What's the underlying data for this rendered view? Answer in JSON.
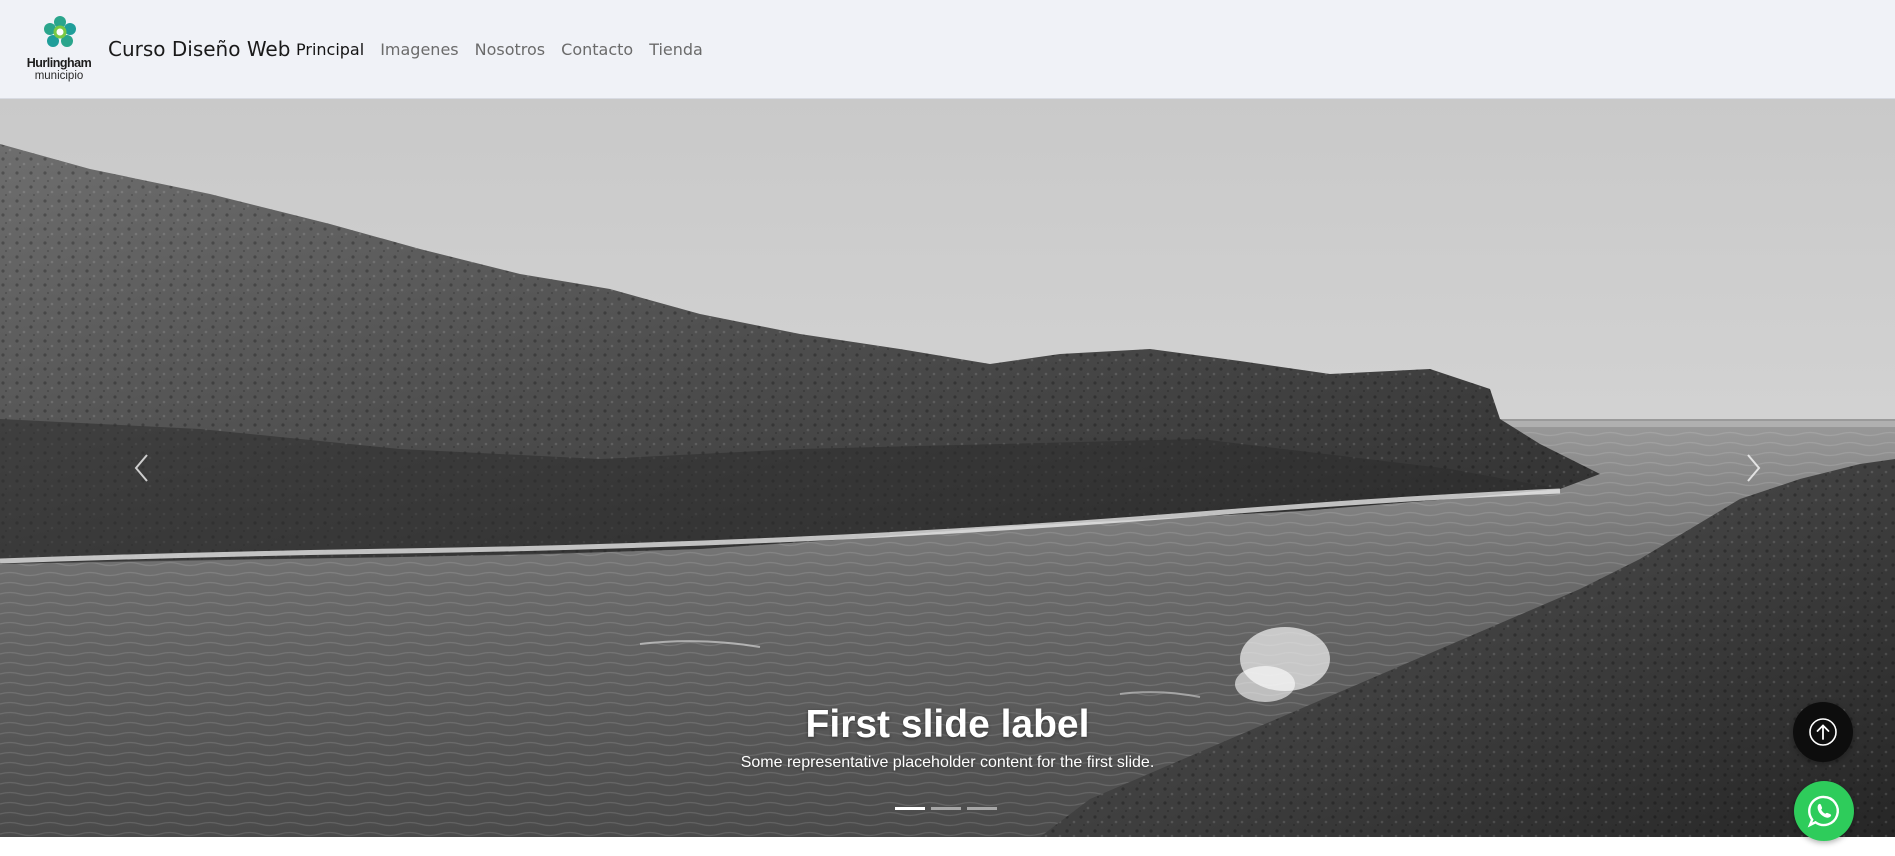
{
  "navbar": {
    "logo": {
      "icon": "flower-logo-icon",
      "name": "Hurlingham",
      "subtitle": "municipio",
      "colors": [
        "#2aa58c",
        "#1f9e9a",
        "#7ac943"
      ]
    },
    "brand": "Curso Diseño Web",
    "links": [
      {
        "label": "Principal",
        "active": true
      },
      {
        "label": "Imagenes",
        "active": false
      },
      {
        "label": "Nosotros",
        "active": false
      },
      {
        "label": "Contacto",
        "active": false
      },
      {
        "label": "Tienda",
        "active": false
      }
    ]
  },
  "carousel": {
    "slide": {
      "image": "black-and-white coastal cliffs and sea",
      "title": "First slide label",
      "text": "Some representative placeholder content for the first slide."
    },
    "prev_icon": "chevron-left-icon",
    "next_icon": "chevron-right-icon",
    "indicators": 3,
    "active_indicator": 0
  },
  "floating": {
    "back_to_top_icon": "arrow-up-icon",
    "whatsapp_icon": "whatsapp-icon",
    "whatsapp_color": "#2ecc5b"
  }
}
